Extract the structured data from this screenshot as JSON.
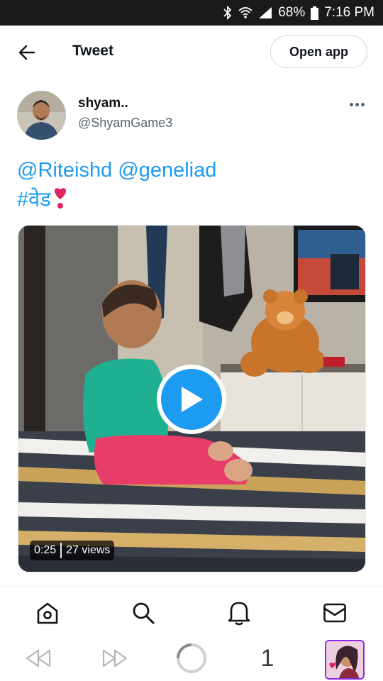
{
  "status_bar": {
    "battery": "68%",
    "time": "7:16 PM"
  },
  "header": {
    "title": "Tweet",
    "open_app": "Open app"
  },
  "tweet": {
    "author_name": "shyam..",
    "author_handle": "@ShyamGame3",
    "mention_1": "@Riteishd",
    "mention_2": "@geneliad",
    "hashtag": "#वेड"
  },
  "video": {
    "duration": "0:25",
    "views": "27 views"
  },
  "browser": {
    "tab_count": "1"
  },
  "colors": {
    "accent": "#1d9bf0",
    "text": "#0f1419",
    "muted": "#536471"
  },
  "icons": {
    "back": "arrow-left-icon",
    "more": "more-dots-icon",
    "play": "play-icon",
    "home": "home-icon",
    "search": "search-icon",
    "notifications": "bell-icon",
    "messages": "mail-icon"
  }
}
